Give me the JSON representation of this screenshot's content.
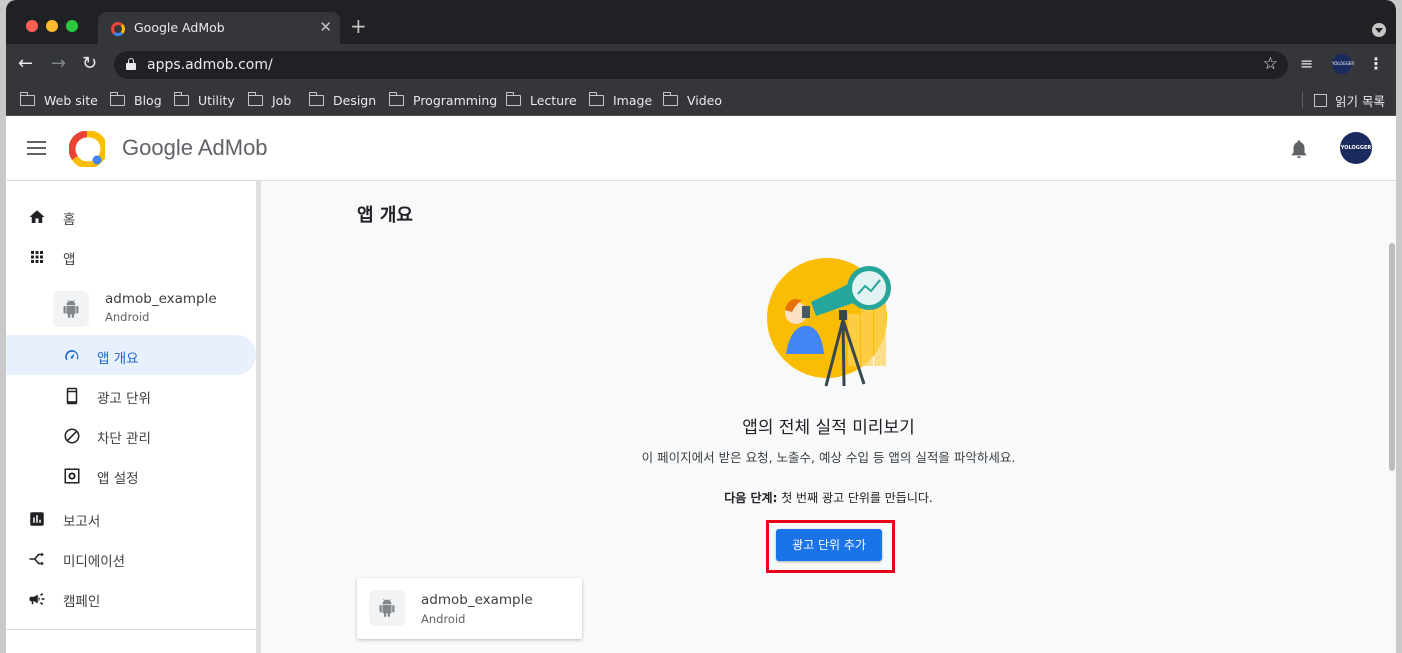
{
  "browser": {
    "tab_title": "Google AdMob",
    "url": "apps.admob.com/",
    "bookmarks": [
      "Web site",
      "Blog",
      "Utility",
      "Job",
      "Design",
      "Programming",
      "Lecture",
      "Image",
      "Video"
    ],
    "reading_list": "읽기 목록",
    "profile_text": "YOLOGGER"
  },
  "header": {
    "brand": "Google AdMob",
    "avatar_text": "YOLOGGER"
  },
  "sidebar": {
    "home": "홈",
    "apps": "앱",
    "app_name": "admob_example",
    "app_platform": "Android",
    "app_overview": "앱 개요",
    "ad_units": "광고 단위",
    "blocking": "차단 관리",
    "app_settings": "앱 설정",
    "reports": "보고서",
    "mediation": "미디에이션",
    "campaigns": "캠페인"
  },
  "main": {
    "page_title": "앱 개요",
    "promo_title": "앱의 전체 실적 미리보기",
    "promo_desc": "이 페이지에서 받은 요청, 노출수, 예상 수입 등 앱의 실적을 파악하세요.",
    "next_step_label": "다음 단계:",
    "next_step_text": " 첫 번째 광고 단위를 만듭니다.",
    "add_button": "광고 단위 추가",
    "card_app_name": "admob_example",
    "card_platform": "Android"
  },
  "colors": {
    "accent": "#1a73e8",
    "highlight": "#e8001b",
    "active_nav_bg": "#e8f0fe"
  }
}
